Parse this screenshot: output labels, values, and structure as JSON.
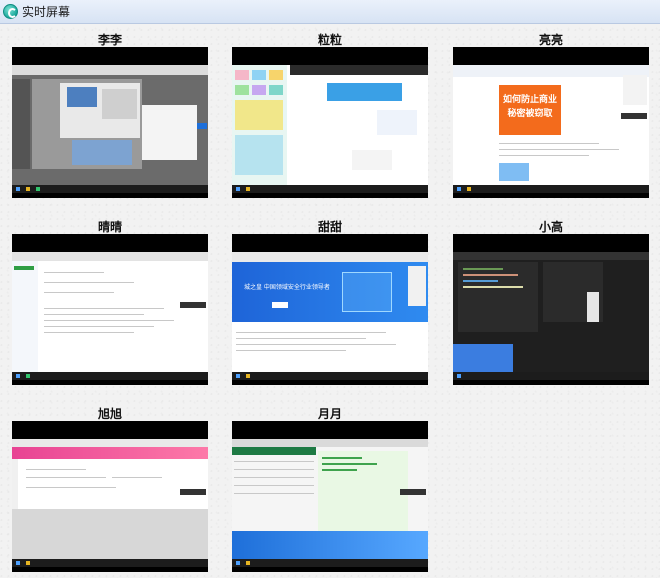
{
  "window": {
    "title": "实时屏幕",
    "icon": "app-logo-icon"
  },
  "tiles": [
    {
      "name": "李李"
    },
    {
      "name": "粒粒"
    },
    {
      "name": "亮亮"
    },
    {
      "name": "晴晴"
    },
    {
      "name": "甜甜"
    },
    {
      "name": "小高"
    },
    {
      "name": "旭旭"
    },
    {
      "name": "月月"
    }
  ],
  "screens": {
    "liangliang_banner": [
      "如何防止商业",
      "秘密被窃取"
    ],
    "tiantian_slogan": "城之皇 中国领域安全行业领导者"
  }
}
